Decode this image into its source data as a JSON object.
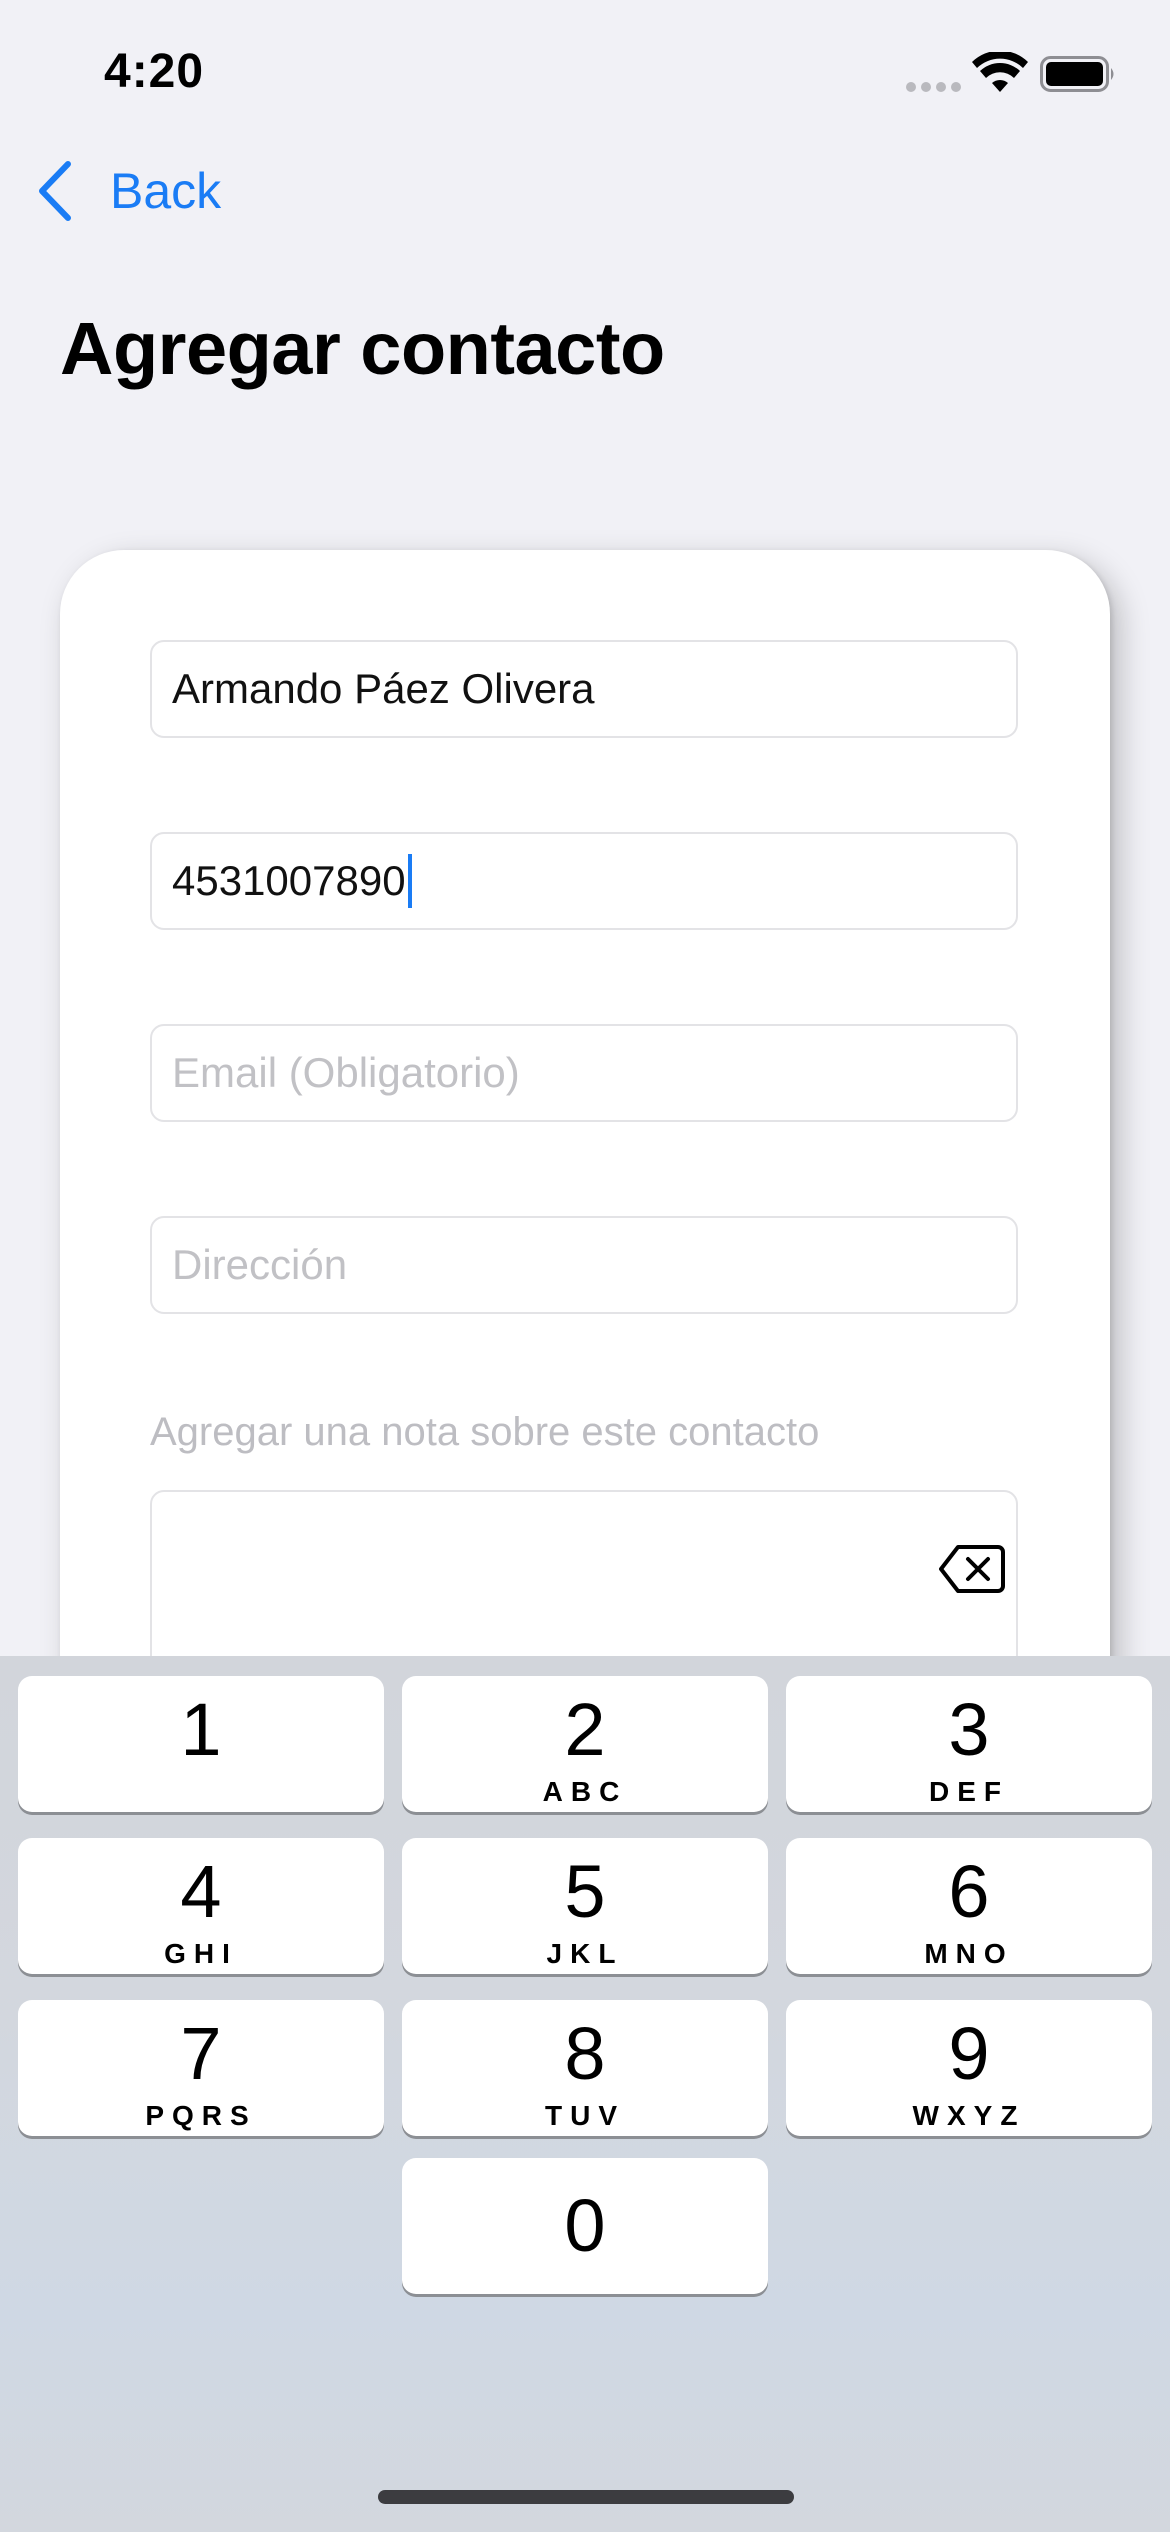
{
  "status_bar": {
    "time": "4:20"
  },
  "nav": {
    "back_label": "Back"
  },
  "page": {
    "title": "Agregar contacto"
  },
  "form": {
    "name_value": "Armando Páez Olivera",
    "phone_value": "4531007890",
    "email_placeholder": "Email (Obligatorio)",
    "address_placeholder": "Dirección",
    "note_label": "Agregar una nota sobre este contacto",
    "note_value": ""
  },
  "keypad": {
    "keys": [
      {
        "digit": "1",
        "letters": ""
      },
      {
        "digit": "2",
        "letters": "ABC"
      },
      {
        "digit": "3",
        "letters": "DEF"
      },
      {
        "digit": "4",
        "letters": "GHI"
      },
      {
        "digit": "5",
        "letters": "JKL"
      },
      {
        "digit": "6",
        "letters": "MNO"
      },
      {
        "digit": "7",
        "letters": "PQRS"
      },
      {
        "digit": "8",
        "letters": "TUV"
      },
      {
        "digit": "9",
        "letters": "WXYZ"
      },
      {
        "digit": "0",
        "letters": ""
      }
    ],
    "delete_icon": "delete-backspace-icon"
  },
  "colors": {
    "accent": "#1a7cf5",
    "background": "#f1f1f6",
    "keyboard_background": "#d3d7de"
  }
}
